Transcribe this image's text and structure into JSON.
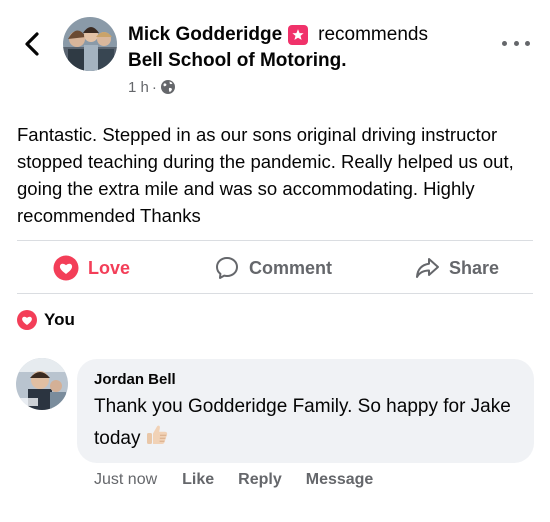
{
  "header": {
    "author": "Mick Godderidge",
    "recommends_text": "recommends",
    "page_name": "Bell School of Motoring.",
    "time": "1 h",
    "separator": "·",
    "back_icon": "chevron-left-icon",
    "more_icon": "more-horizontal-icon",
    "audience_icon": "globe-icon",
    "recommend_icon": "recommendation-star-icon"
  },
  "post": {
    "text": "Fantastic. Stepped in as our sons original driving instructor stopped teaching during the pandemic. Really helped us out, going the extra mile and was so accommodating. Highly recommended Thanks"
  },
  "actions": {
    "love": "Love",
    "comment": "Comment",
    "share": "Share"
  },
  "reactions": {
    "label": "You"
  },
  "comment": {
    "author": "Jordan Bell",
    "text": "Thank you Godderidge Family.  So happy for Jake today",
    "emoji": "thumbs-up",
    "time": "Just now",
    "like": "Like",
    "reply": "Reply",
    "message": "Message"
  },
  "colors": {
    "love_red": "#f33e58",
    "recommend_pink": "#f0326a",
    "secondary_text": "#65676b",
    "bubble_bg": "#f0f2f5"
  }
}
